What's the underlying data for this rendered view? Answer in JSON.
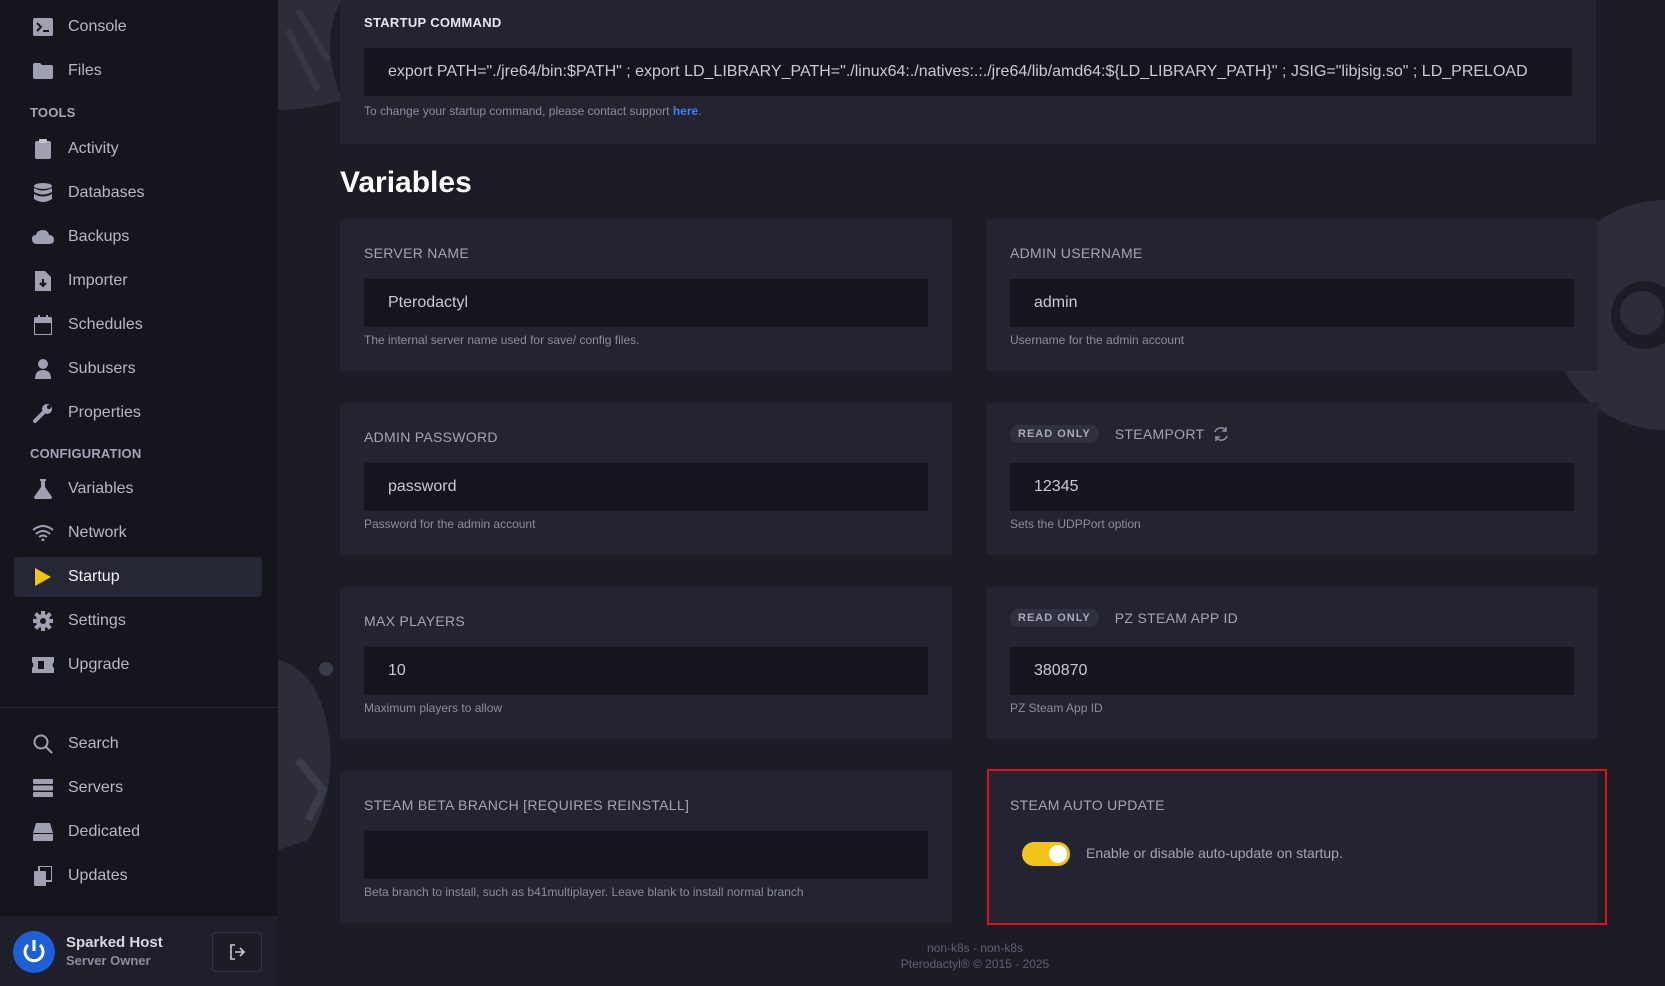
{
  "sidebar": {
    "items_top": [
      {
        "label": "Console",
        "icon": "terminal-icon"
      },
      {
        "label": "Files",
        "icon": "folder-icon"
      }
    ],
    "tools_title": "TOOLS",
    "tools": [
      {
        "label": "Activity",
        "icon": "clipboard-icon"
      },
      {
        "label": "Databases",
        "icon": "database-icon"
      },
      {
        "label": "Backups",
        "icon": "cloud-icon"
      },
      {
        "label": "Importer",
        "icon": "file-import-icon"
      },
      {
        "label": "Schedules",
        "icon": "calendar-icon"
      },
      {
        "label": "Subusers",
        "icon": "user-icon"
      },
      {
        "label": "Properties",
        "icon": "wrench-icon"
      }
    ],
    "config_title": "CONFIGURATION",
    "config": [
      {
        "label": "Variables",
        "icon": "flask-icon"
      },
      {
        "label": "Network",
        "icon": "wifi-icon"
      },
      {
        "label": "Startup",
        "icon": "play-icon"
      },
      {
        "label": "Settings",
        "icon": "gear-icon"
      },
      {
        "label": "Upgrade",
        "icon": "ticket-icon"
      }
    ],
    "bottom": [
      {
        "label": "Search",
        "icon": "search-icon"
      },
      {
        "label": "Servers",
        "icon": "server-icon"
      },
      {
        "label": "Dedicated",
        "icon": "hdd-icon"
      },
      {
        "label": "Updates",
        "icon": "copy-icon"
      }
    ],
    "user": {
      "name": "Sparked Host",
      "role": "Server Owner"
    }
  },
  "startup": {
    "label": "STARTUP COMMAND",
    "command": "export PATH=\"./jre64/bin:$PATH\" ; export LD_LIBRARY_PATH=\"./linux64:./natives:.:./jre64/lib/amd64:${LD_LIBRARY_PATH}\" ; JSIG=\"libjsig.so\" ; LD_PRELOAD",
    "help_prefix": "To change your startup command, please contact support ",
    "help_link": "here",
    "help_suffix": "."
  },
  "variables_title": "Variables",
  "vars": {
    "server_name": {
      "label": "SERVER NAME",
      "value": "Pterodactyl",
      "help": "The internal server name used for save/ config files."
    },
    "admin_username": {
      "label": "ADMIN USERNAME",
      "value": "admin",
      "help": "Username for the admin account"
    },
    "admin_password": {
      "label": "ADMIN PASSWORD",
      "value": "password",
      "help": "Password for the admin account"
    },
    "steamport": {
      "badge": "READ ONLY",
      "label": "STEAMPORT",
      "value": "12345",
      "help": "Sets the UDPPort option"
    },
    "max_players": {
      "label": "MAX PLAYERS",
      "value": "10",
      "help": "Maximum players to allow"
    },
    "pz_app_id": {
      "badge": "READ ONLY",
      "label": "PZ STEAM APP ID",
      "value": "380870",
      "help": "PZ Steam App ID"
    },
    "steam_beta": {
      "label": "STEAM BETA BRANCH [REQUIRES REINSTALL]",
      "value": "",
      "help": "Beta branch to install, such as b41multiplayer. Leave blank to install normal branch"
    },
    "steam_auto_update": {
      "label": "STEAM AUTO UPDATE",
      "toggle_text": "Enable or disable auto-update on startup.",
      "enabled": true
    }
  },
  "footer": {
    "line1": "non-k8s - non-k8s",
    "line2": "Pterodactyl® © 2015 - 2025"
  },
  "colors": {
    "accent": "#f0c419",
    "link": "#3b82f6",
    "highlight": "#e0101b",
    "card": "#232430",
    "input": "#15161d"
  }
}
